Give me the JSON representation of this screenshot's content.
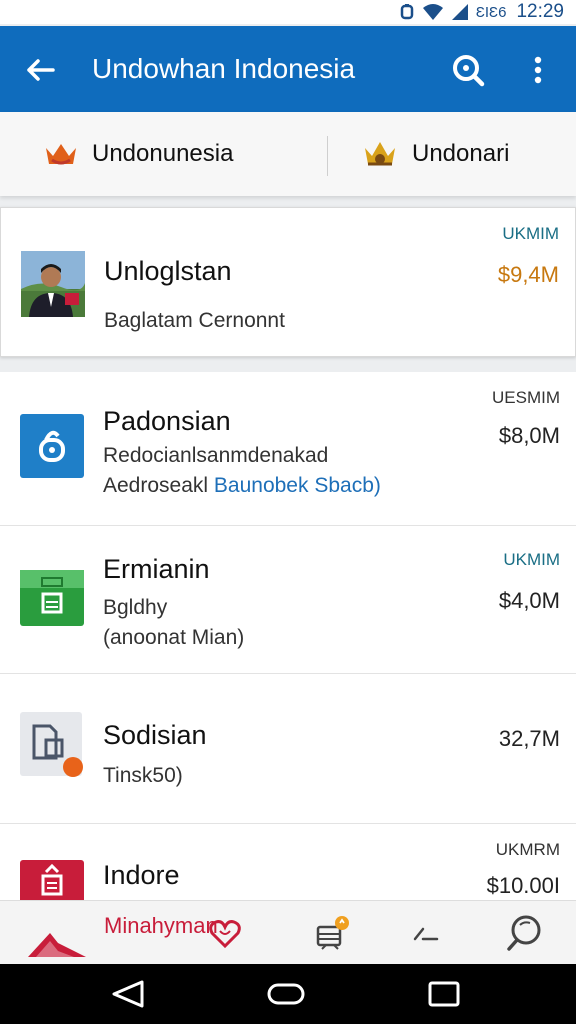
{
  "status_bar": {
    "signal_text": "ƐIƐ6",
    "time": "12:29"
  },
  "app_bar": {
    "title": "Undowhan Indonesia"
  },
  "tabs": [
    {
      "label": "Undonunesia",
      "icon": "crown-icon"
    },
    {
      "label": "Undonari",
      "icon": "crown-icon"
    }
  ],
  "list": [
    {
      "name": "Unloglstan",
      "subtitle": "Baglatam Cernonnt",
      "code": "UKMIM",
      "price": "$9,4M",
      "icon": "profile-photo"
    },
    {
      "name": "Padonsian",
      "subtitle": "Redocianlsanmdenakad",
      "subtitle2_prefix": "Aedroseakl",
      "subtitle2_link": "Baunobek Sbacb)",
      "code": "UESMIM",
      "price": "$8,0M",
      "icon": "lock-icon"
    },
    {
      "name": "Ermianin",
      "subtitle": "Bgldhy",
      "subtitle2": "(anoonat Mian)",
      "code": "UKMIM",
      "price": "$4,0M",
      "icon": "briefcase-icon"
    },
    {
      "name": "Sodisian",
      "subtitle": "Tinsk50)",
      "code": "",
      "price": "32,7M",
      "icon": "document-icon"
    },
    {
      "name": "Indore",
      "subtitle": "",
      "code": "UKMRM",
      "price": "$10.00I",
      "icon": "flag-icon"
    }
  ],
  "bottom_nav": {
    "label": "Minahyman"
  },
  "colors": {
    "app_bar": "#0f6cbd",
    "code_teal": "#1a6e85",
    "price_orange": "#c7780f",
    "accent_red": "#c81d3a",
    "link_blue": "#1e6fb8"
  }
}
